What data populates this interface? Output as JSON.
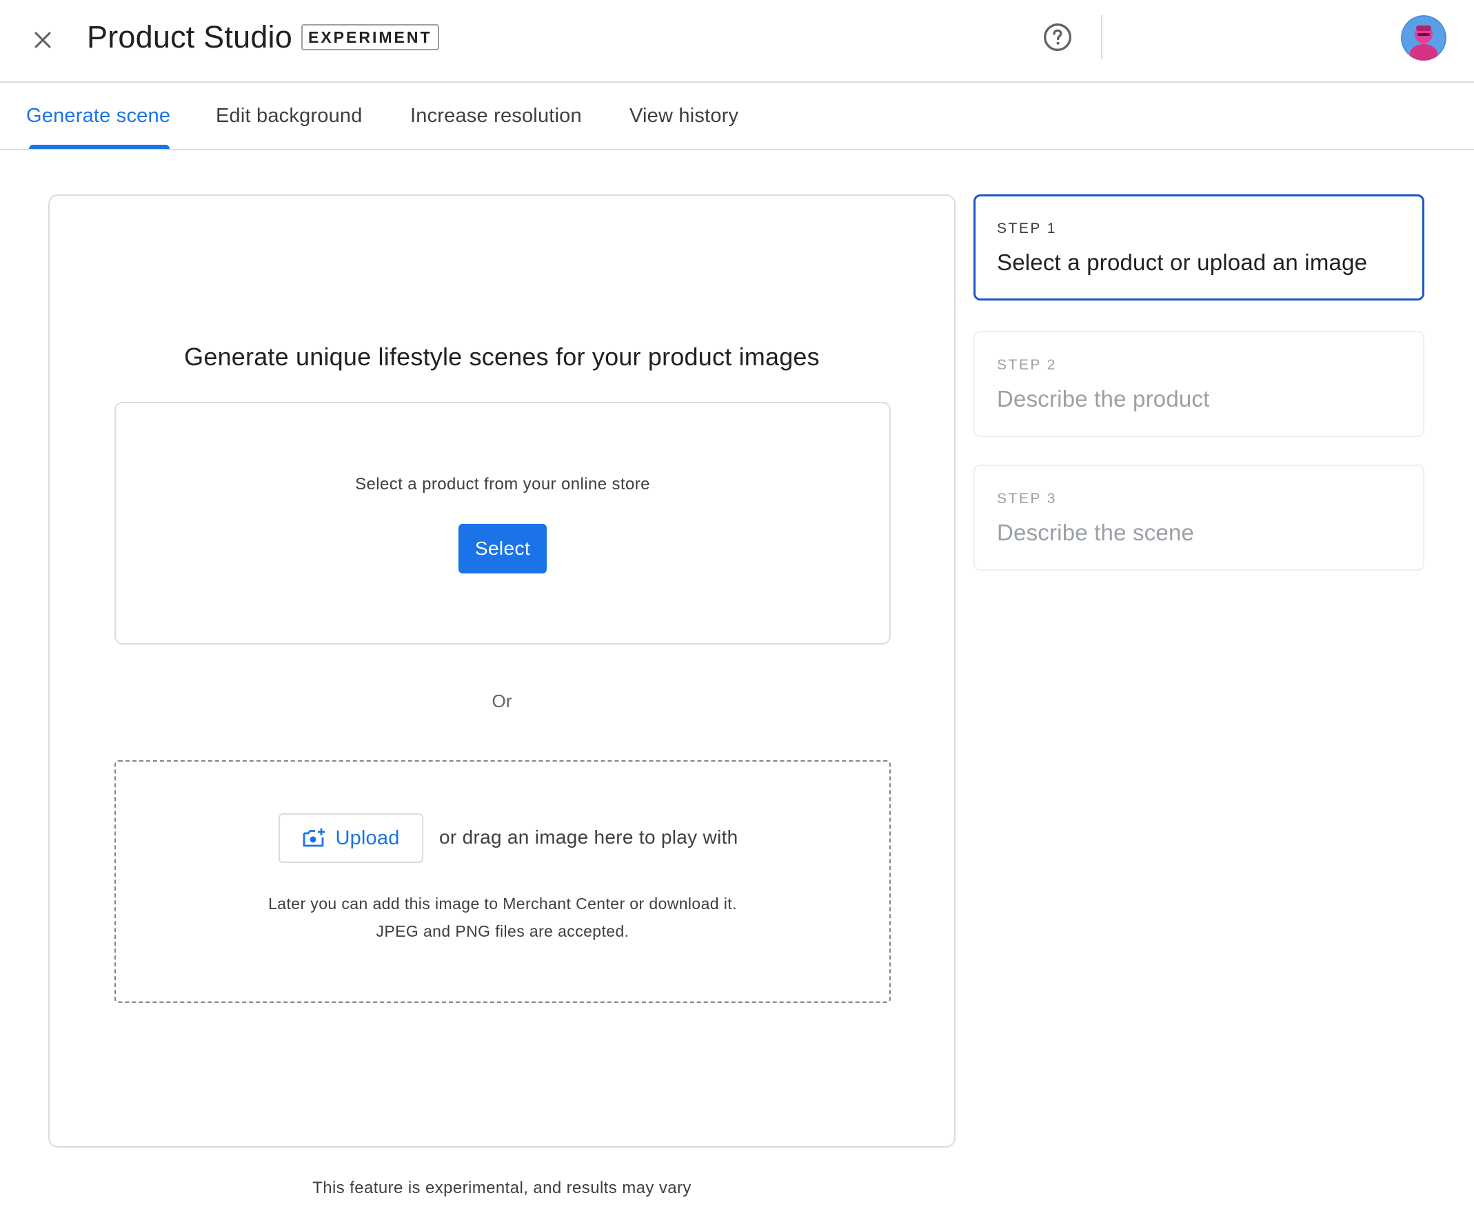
{
  "header": {
    "title": "Product Studio",
    "badge": "EXPERIMENT",
    "close_icon": "close-icon",
    "help_icon": "help-circle-icon",
    "avatar": "user-avatar"
  },
  "tabs": [
    {
      "label": "Generate scene",
      "active": true
    },
    {
      "label": "Edit background",
      "active": false
    },
    {
      "label": "Increase resolution",
      "active": false
    },
    {
      "label": "View history",
      "active": false
    }
  ],
  "main": {
    "heading": "Generate unique lifestyle scenes for your product images",
    "select_section": {
      "caption": "Select a product from your online store",
      "button_label": "Select"
    },
    "or_label": "Or",
    "upload_section": {
      "button_icon": "add-photo-icon",
      "button_label": "Upload",
      "drag_text": "or drag an image here to play with",
      "note_line1": "Later you can add this image to Merchant Center or download it.",
      "note_line2": "JPEG and PNG files are accepted."
    },
    "footer_note": "This feature is experimental, and results may vary"
  },
  "steps": [
    {
      "label": "STEP 1",
      "title": "Select a product or upload an image",
      "active": true
    },
    {
      "label": "STEP 2",
      "title": "Describe the product",
      "active": false
    },
    {
      "label": "STEP 3",
      "title": "Describe the scene",
      "active": false
    }
  ],
  "colors": {
    "accent": "#1a73e8",
    "active_step_border": "#1a56c8",
    "border": "#dadce0",
    "muted_text": "#9aa0a6"
  }
}
